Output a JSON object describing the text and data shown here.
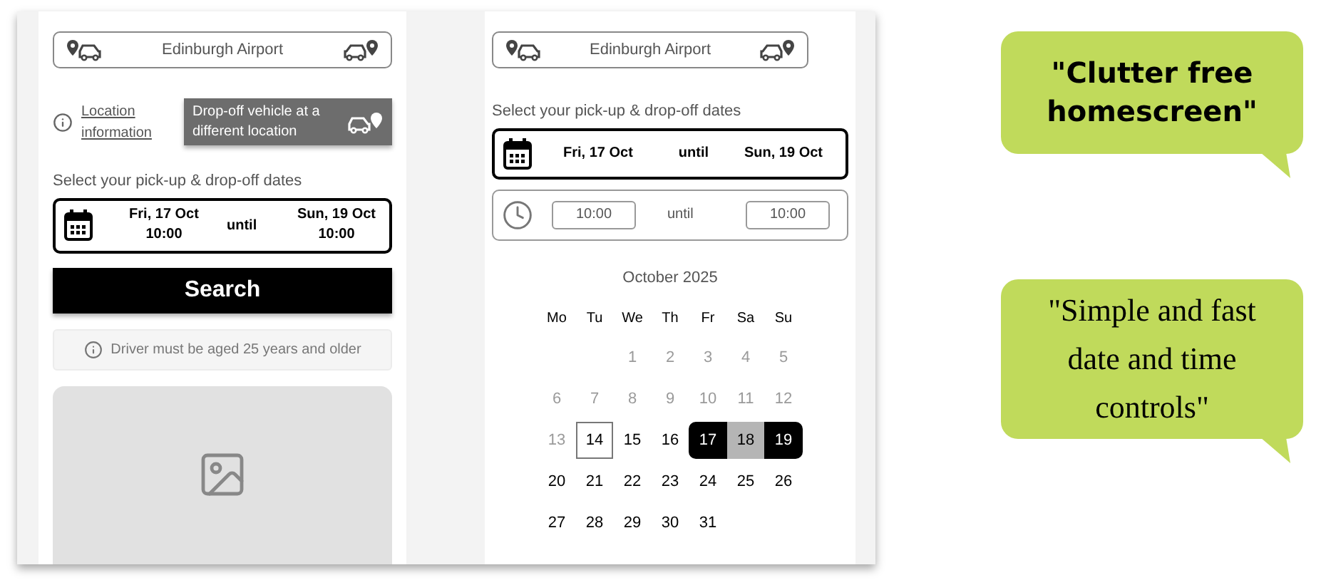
{
  "home_screen": {
    "location_field": {
      "value": "Edinburgh Airport"
    },
    "location_info_link": "Location information",
    "different_dropoff_button": "Drop-off vehicle at a different location",
    "dates_label": "Select your pick-up & drop-off dates",
    "date_range": {
      "pickup_date": "Fri, 17 Oct",
      "pickup_time": "10:00",
      "separator": "until",
      "dropoff_date": "Sun, 19 Oct",
      "dropoff_time": "10:00"
    },
    "search_button": "Search",
    "age_notice": "Driver must be aged 25 years and older"
  },
  "date_screen": {
    "location_field": {
      "value": "Edinburgh Airport"
    },
    "dates_label": "Select your pick-up & drop-off dates",
    "date_row": {
      "pickup_date": "Fri, 17 Oct",
      "separator": "until",
      "dropoff_date": "Sun, 19 Oct"
    },
    "time_row": {
      "pickup_time": "10:00",
      "separator": "until",
      "dropoff_time": "10:00"
    },
    "calendar": {
      "month": "October 2025",
      "weekdays": [
        "Mo",
        "Tu",
        "We",
        "Th",
        "Fr",
        "Sa",
        "Su"
      ],
      "weeks": [
        [
          {
            "day": "1",
            "disabled": true,
            "outlined": false,
            "selected": false,
            "in_range": false
          },
          {
            "day": "2",
            "disabled": true,
            "outlined": false,
            "selected": false,
            "in_range": false
          },
          {
            "day": "3",
            "disabled": true,
            "outlined": false,
            "selected": false,
            "in_range": false
          },
          {
            "day": "4",
            "disabled": true,
            "outlined": false,
            "selected": false,
            "in_range": false
          },
          {
            "day": "5",
            "disabled": true,
            "outlined": false,
            "selected": false,
            "in_range": false
          }
        ],
        [
          {
            "day": "6",
            "disabled": true,
            "outlined": false,
            "selected": false,
            "in_range": false
          },
          {
            "day": "7",
            "disabled": true,
            "outlined": false,
            "selected": false,
            "in_range": false
          },
          {
            "day": "8",
            "disabled": true,
            "outlined": false,
            "selected": false,
            "in_range": false
          },
          {
            "day": "9",
            "disabled": true,
            "outlined": false,
            "selected": false,
            "in_range": false
          },
          {
            "day": "10",
            "disabled": true,
            "outlined": false,
            "selected": false,
            "in_range": false
          },
          {
            "day": "11",
            "disabled": true,
            "outlined": false,
            "selected": false,
            "in_range": false
          },
          {
            "day": "12",
            "disabled": true,
            "outlined": false,
            "selected": false,
            "in_range": false
          }
        ],
        [
          {
            "day": "13",
            "disabled": true,
            "outlined": false,
            "selected": false,
            "in_range": false
          },
          {
            "day": "14",
            "disabled": false,
            "outlined": true,
            "selected": false,
            "in_range": false
          },
          {
            "day": "15",
            "disabled": false,
            "outlined": false,
            "selected": false,
            "in_range": false
          },
          {
            "day": "16",
            "disabled": false,
            "outlined": false,
            "selected": false,
            "in_range": false
          },
          {
            "day": "17",
            "disabled": false,
            "outlined": false,
            "selected": true,
            "in_range": false
          },
          {
            "day": "18",
            "disabled": false,
            "outlined": false,
            "selected": false,
            "in_range": true
          },
          {
            "day": "19",
            "disabled": false,
            "outlined": false,
            "selected": true,
            "in_range": false
          }
        ],
        [
          {
            "day": "20",
            "disabled": false,
            "outlined": false,
            "selected": false,
            "in_range": false
          },
          {
            "day": "21",
            "disabled": false,
            "outlined": false,
            "selected": false,
            "in_range": false
          },
          {
            "day": "22",
            "disabled": false,
            "outlined": false,
            "selected": false,
            "in_range": false
          },
          {
            "day": "23",
            "disabled": false,
            "outlined": false,
            "selected": false,
            "in_range": false
          },
          {
            "day": "24",
            "disabled": false,
            "outlined": false,
            "selected": false,
            "in_range": false
          },
          {
            "day": "25",
            "disabled": false,
            "outlined": false,
            "selected": false,
            "in_range": false
          },
          {
            "day": "26",
            "disabled": false,
            "outlined": false,
            "selected": false,
            "in_range": false
          }
        ],
        [
          {
            "day": "27",
            "disabled": false,
            "outlined": false,
            "selected": false,
            "in_range": false
          },
          {
            "day": "28",
            "disabled": false,
            "outlined": false,
            "selected": false,
            "in_range": false
          },
          {
            "day": "29",
            "disabled": false,
            "outlined": false,
            "selected": false,
            "in_range": false
          },
          {
            "day": "30",
            "disabled": false,
            "outlined": false,
            "selected": false,
            "in_range": false
          },
          {
            "day": "31",
            "disabled": false,
            "outlined": false,
            "selected": false,
            "in_range": false
          }
        ]
      ]
    }
  },
  "callouts": [
    {
      "text": "\"Clutter free homescreen\"",
      "kind": "bold"
    },
    {
      "text": "\"Simple and fast date and time controls\"",
      "kind": "serif"
    }
  ]
}
